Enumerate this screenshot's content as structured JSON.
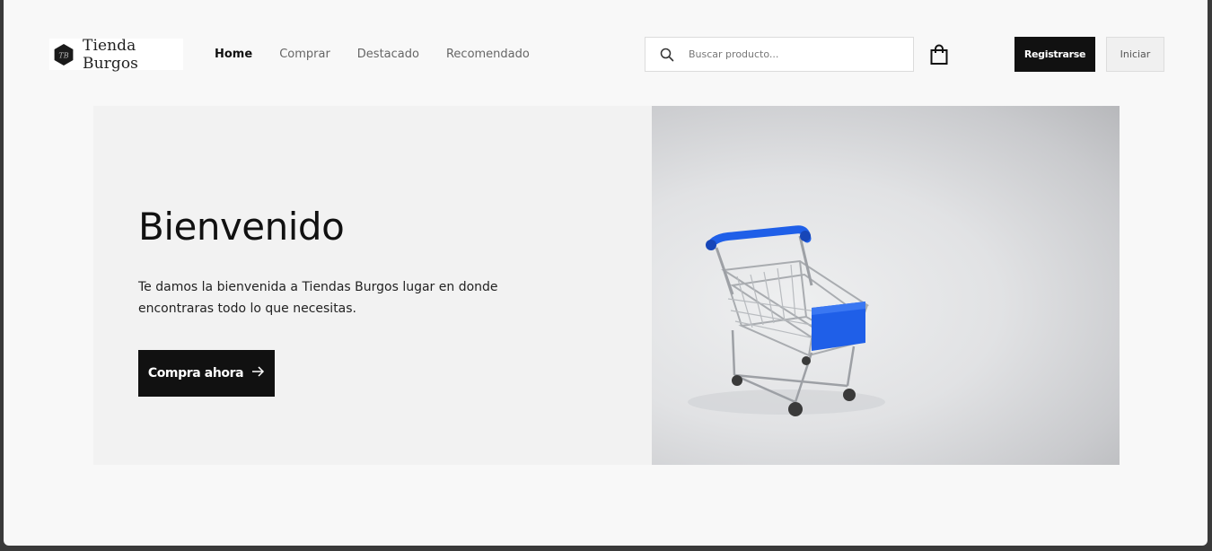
{
  "brand": {
    "name": "Tienda Burgos",
    "logo_icon": "hexagon-logo-icon"
  },
  "nav": {
    "items": [
      {
        "label": "Home",
        "active": true
      },
      {
        "label": "Comprar",
        "active": false
      },
      {
        "label": "Destacado",
        "active": false
      },
      {
        "label": "Recomendado",
        "active": false
      }
    ]
  },
  "search": {
    "placeholder": "Buscar producto...",
    "value": "",
    "icon": "search-icon"
  },
  "cart": {
    "icon": "shopping-bag-icon"
  },
  "auth": {
    "register_label": "Registrarse",
    "login_label": "Iniciar"
  },
  "hero": {
    "title": "Bienvenido",
    "text": "Te damos la bienvenida a Tiendas Burgos lugar en donde encontraras todo lo que necesitas.",
    "cta_label": "Compra ahora",
    "cta_icon": "arrow-right-icon",
    "image": "shopping-cart-image"
  },
  "colors": {
    "accent": "#111111",
    "cart_blue": "#1f5fe8",
    "hero_bg": "#f2f2f2"
  }
}
